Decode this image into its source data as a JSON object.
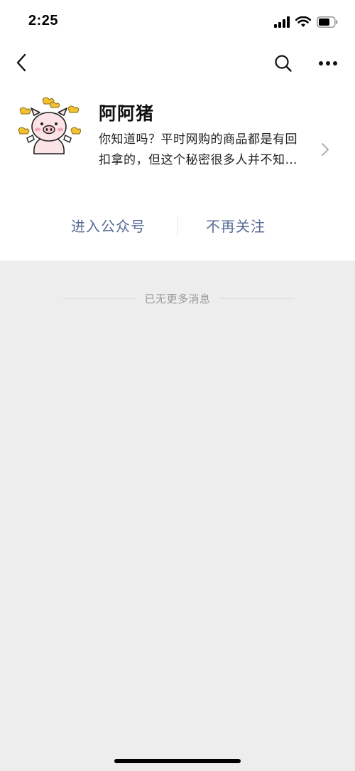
{
  "status_bar": {
    "time": "2:25",
    "icons": [
      "cellular-signal-icon",
      "wifi-icon",
      "battery-icon"
    ]
  },
  "nav_bar": {
    "back_icon": "chevron-left-icon",
    "search_icon": "search-icon",
    "more_icon": "more-icon"
  },
  "account": {
    "name": "阿阿猪",
    "avatar_icon": "pig-avatar-icon",
    "description_lines": [
      "你知道吗？平时网购的商品都是有回",
      "扣拿的，但这个秘密很多人并不知…"
    ]
  },
  "actions": {
    "enter_label": "进入公众号",
    "unfollow_label": "不再关注"
  },
  "messages": {
    "no_more_text": "已无更多消息"
  },
  "colors": {
    "link_blue": "#576b95",
    "background_gray": "#ededed",
    "card_white": "#ffffff",
    "hint_gray": "#9a9a9a"
  }
}
